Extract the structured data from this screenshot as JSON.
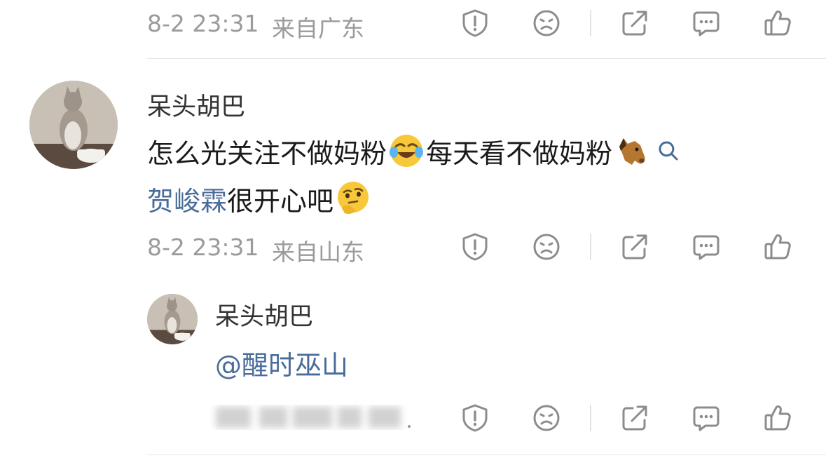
{
  "comment_top": {
    "time": "8-2 23:31",
    "location": "来自广东"
  },
  "comment_main": {
    "username": "呆头胡巴",
    "line1": "怎么光关注不做妈粉",
    "line1b": "每天看不做妈粉",
    "mention": "贺峻霖",
    "line2": "很开心吧",
    "time": "8-2 23:31",
    "location": "来自山东"
  },
  "reply": {
    "username": "呆头胡巴",
    "mention": "@醒时巫山"
  },
  "icons": {
    "report": "exclamation-shield-icon",
    "dislike": "sad-face-icon",
    "share": "share-arrow-icon",
    "comment": "comment-bubble-icon",
    "like": "thumbs-up-icon"
  },
  "colors": {
    "link": "#4a6c9b",
    "meta": "#9b9b9b",
    "icon": "#8c8c8c"
  }
}
